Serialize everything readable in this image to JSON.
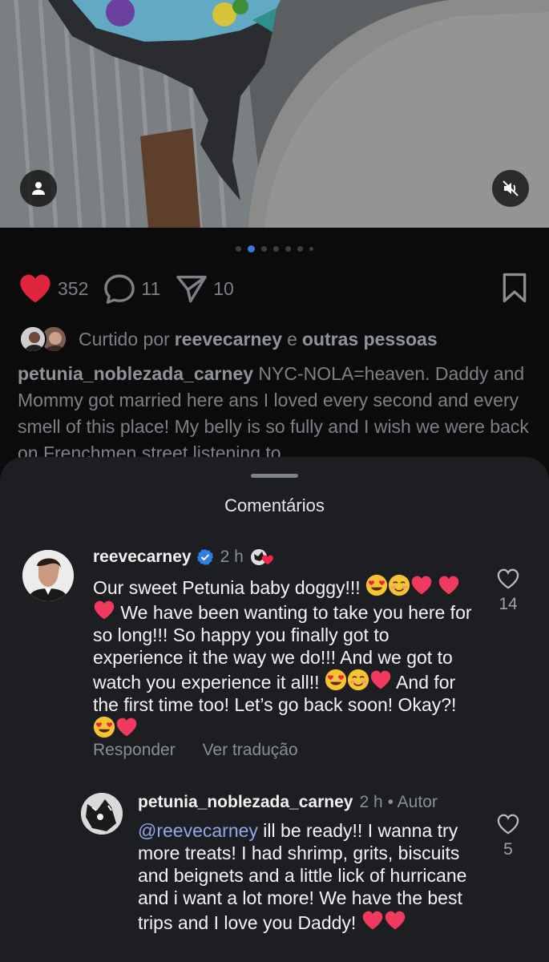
{
  "post": {
    "likes_count": "352",
    "comments_count": "11",
    "shares_count": "10",
    "carousel": {
      "total": 7,
      "active_index": 1
    },
    "liked_by": {
      "prefix": "Curtido por",
      "user": "reevecarney",
      "conjunction": "e",
      "others": "outras pessoas"
    },
    "caption": {
      "username": "petunia_noblezada_carney",
      "text": "NYC-NOLA=heaven. Daddy and Mommy got married here ans I loved every second and every smell of this place! My belly is so fully and I wish we were back on Frenchmen street listening to"
    }
  },
  "comments_sheet": {
    "title": "Comentários",
    "comments": [
      {
        "username": "reevecarney",
        "verified": true,
        "time": "2 h",
        "parts": [
          "Our sweet Petunia baby doggy!!! ",
          " We have been wanting to take you here for so long!!! So happy you finally got to experience it the way we do!!! And we got to watch you experience it all!! ",
          " And for the first time too! Let’s go back soon! Okay?! "
        ],
        "like_count": "14",
        "reply_label": "Responder",
        "translate_label": "Ver tradução"
      },
      {
        "username": "petunia_noblezada_carney",
        "time": "2 h",
        "author_label": "• Autor",
        "mention": "@reevecarney",
        "text": " ill be ready!! I wanna try more treats! I had shrimp, grits, biscuits and beignets and a little lick of hurricane and i want a lot more! We have the best trips and I love you Daddy! ",
        "like_count": "5"
      }
    ]
  },
  "colors": {
    "heart_red": "#e0263f",
    "link_blue": "#8fa8e8",
    "verified_blue": "#2f7de6",
    "sheet_bg": "#1c1e22"
  }
}
